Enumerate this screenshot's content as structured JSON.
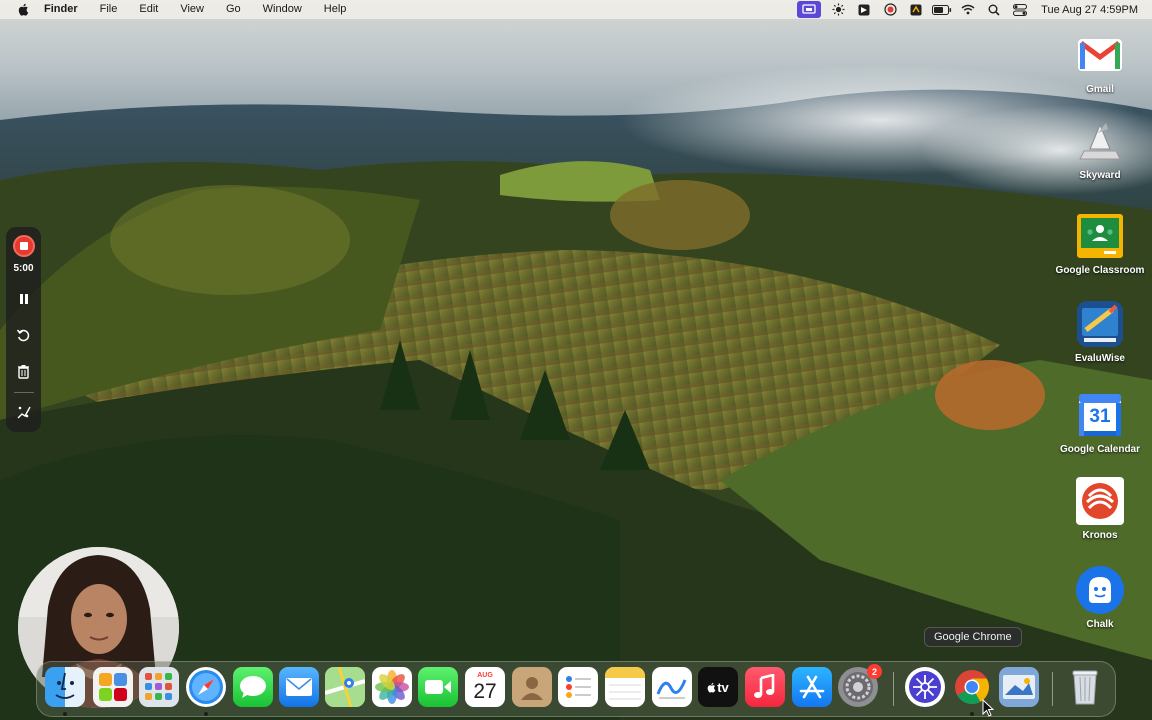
{
  "menubar": {
    "app_name": "Finder",
    "menus": [
      "File",
      "Edit",
      "View",
      "Go",
      "Window",
      "Help"
    ],
    "clock": "Tue Aug 27  4:59PM",
    "status_icons": [
      "screen-share-icon",
      "sun-icon",
      "notion-icon",
      "record-icon",
      "app-icon",
      "battery-icon",
      "wifi-icon",
      "search-icon",
      "control-center-icon"
    ]
  },
  "recorder": {
    "timer": "5:00",
    "tools": [
      "stop-record-icon",
      "pause-icon",
      "restart-icon",
      "trash-icon",
      "draw-icon"
    ]
  },
  "desktop_icons": [
    {
      "label": "Gmail",
      "icon": "gmail-icon"
    },
    {
      "label": "Skyward",
      "icon": "skyward-icon"
    },
    {
      "label": "Google Classroom",
      "icon": "google-classroom-icon"
    },
    {
      "label": "EvaluWise",
      "icon": "evaluwise-icon"
    },
    {
      "label": "Google Calendar",
      "icon": "google-calendar-icon",
      "day": "31"
    },
    {
      "label": "Kronos",
      "icon": "kronos-icon"
    },
    {
      "label": "Chalk",
      "icon": "chalk-icon"
    }
  ],
  "dock": {
    "calendar_month": "AUG",
    "calendar_day": "27",
    "settings_badge": "2",
    "tv_label": "tv",
    "apps": [
      "Finder",
      "Toolbox",
      "Launchpad",
      "Safari",
      "Messages",
      "Mail",
      "Maps",
      "Photos",
      "FaceTime",
      "Calendar",
      "Contacts",
      "Reminders",
      "Notes",
      "Freeform",
      "TV",
      "Music",
      "App Store",
      "System Settings",
      "Perplexity",
      "Google Chrome",
      "Preview",
      "Trash"
    ]
  },
  "tooltip": "Google Chrome",
  "colors": {
    "menubar_bg": "#f0eee8",
    "recorder_red": "#e8392d",
    "screen_share_highlight": "#5b48d6"
  }
}
